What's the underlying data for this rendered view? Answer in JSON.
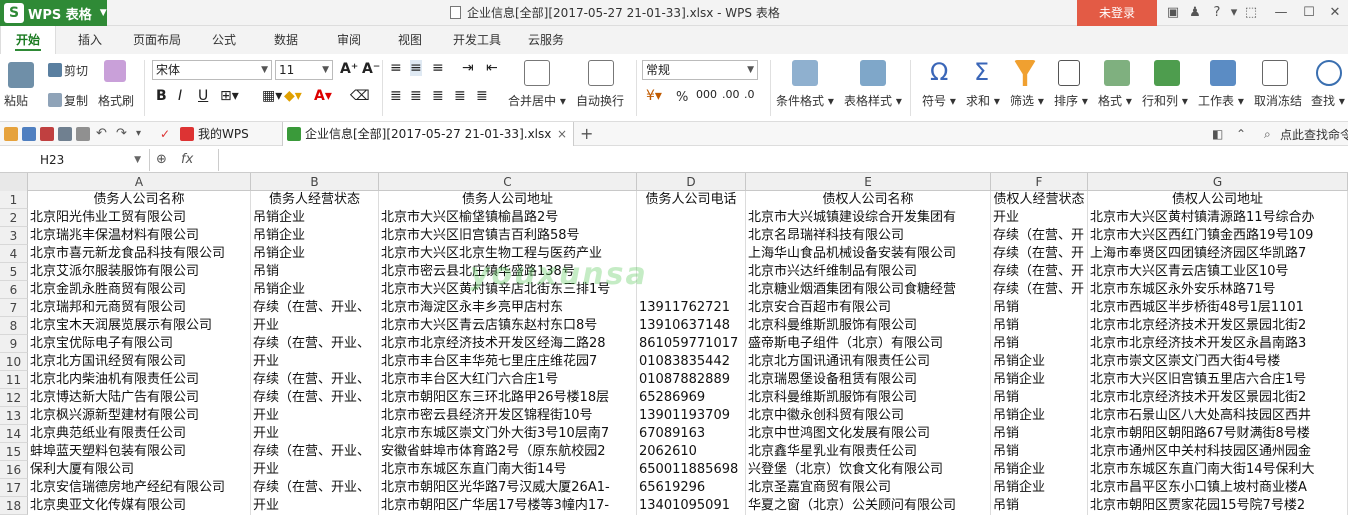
{
  "titlebar": {
    "app_name": "WPS 表格",
    "doc_title": "企业信息[全部][2017-05-27 21-01-33].xlsx - WPS 表格",
    "login": "未登录"
  },
  "tabs": [
    "开始",
    "插入",
    "页面布局",
    "公式",
    "数据",
    "审阅",
    "视图",
    "开发工具",
    "云服务"
  ],
  "ribbon": {
    "paste": "粘贴",
    "cut": "剪切",
    "copy": "复制",
    "format_painter": "格式刷",
    "font_name": "宋体",
    "font_size": "11",
    "merge_center": "合并居中",
    "wrap_text": "自动换行",
    "number_format": "常规",
    "percent": "%",
    "conditional_format": "条件格式",
    "table_style": "表格样式",
    "symbol": "符号",
    "sum": "求和",
    "filter": "筛选",
    "sort": "排序",
    "format": "格式",
    "rows_cols": "行和列",
    "worksheet": "工作表",
    "freeze": "取消冻结",
    "find": "查找"
  },
  "quickbar": {
    "my_wps": "我的WPS",
    "doc_tab": "企业信息[全部][2017-05-27 21-01-33].xlsx",
    "search": "点此查找命令"
  },
  "formula": {
    "cell_ref": "H23",
    "fx": "fx",
    "value": ""
  },
  "columns": [
    "A",
    "B",
    "C",
    "D",
    "E",
    "F",
    "G"
  ],
  "rows": [
    [
      "债务人公司名称",
      "债务人经营状态",
      "债务人公司地址",
      "债务人公司电话",
      "债权人公司名称",
      "债权人经营状态",
      "债权人公司地址"
    ],
    [
      "北京阳光伟业工贸有限公司",
      "吊销企业",
      "北京市大兴区榆垡镇榆昌路2号",
      "",
      "北京市大兴城镇建设综合开发集团有",
      "开业",
      "北京市大兴区黄村镇清源路11号综合办"
    ],
    [
      "北京瑞兆丰保温材料有限公司",
      "吊销企业",
      "北京市大兴区旧宫镇吉百利路58号",
      "",
      "北京名昂瑞祥科技有限公司",
      "存续（在营、开",
      "北京市大兴区西红门镇金西路19号109"
    ],
    [
      "北京市喜元新龙食品科技有限公司",
      "吊销企业",
      "北京市大兴区北京生物工程与医药产业",
      "",
      "上海华山食品机械设备安装有限公司",
      "存续（在营、开",
      "上海市奉贤区四团镇经济园区华凯路7"
    ],
    [
      "北京艾派尔服装服饰有限公司",
      "吊销",
      "北京市密云县北庄镇华盛路138号",
      "",
      "北京市兴达纤维制品有限公司",
      "存续（在营、开",
      "北京市大兴区青云店镇工业区10号"
    ],
    [
      "北京金凯永胜商贸有限公司",
      "吊销企业",
      "北京市大兴区黄村镇辛店北街东三排1号",
      "",
      "北京糖业烟酒集团有限公司食糖经营",
      "存续（在营、开",
      "北京市东城区永外安乐林路71号"
    ],
    [
      "北京瑞邦和元商贸有限公司",
      "存续（在营、开业、",
      "北京市海淀区永丰乡亮甲店村东",
      "13911762721",
      "北京安合百超市有限公司",
      "吊销",
      "北京市西城区半步桥街48号1层1101"
    ],
    [
      "北京宝木天润展览展示有限公司",
      "开业",
      "北京市大兴区青云店镇东赵村东口8号",
      "13910637148",
      "北京科曼维斯凯服饰有限公司",
      "吊销",
      "北京市北京经济技术开发区景园北街2"
    ],
    [
      "北京宝优际电子有限公司",
      "存续（在营、开业、",
      "北京市北京经济技术开发区经海二路28",
      "861059771017",
      "盛帝斯电子组件（北京）有限公司",
      "吊销",
      "北京市北京经济技术开发区永昌南路3"
    ],
    [
      "北京北方国讯经贸有限公司",
      "开业",
      "北京市丰台区丰华苑七里庄庄维花园7",
      "01083835442",
      "北京北方国讯通讯有限责任公司",
      "吊销企业",
      "北京市崇文区崇文门西大街4号楼"
    ],
    [
      "北京北内柴油机有限责任公司",
      "存续（在营、开业、",
      "北京市丰台区大红门六合庄1号",
      "01087882889",
      "北京瑞恩堡设备租赁有限公司",
      "吊销企业",
      "北京市大兴区旧宫镇五里店六合庄1号"
    ],
    [
      "北京博达新大陆广告有限公司",
      "存续（在营、开业、",
      "北京市朝阳区东三环北路甲26号楼18层",
      "65286969",
      "北京科曼维斯凯服饰有限公司",
      "吊销",
      "北京市北京经济技术开发区景园北街2"
    ],
    [
      "北京枫兴源新型建材有限公司",
      "开业",
      "北京市密云县经济开发区锦程街10号",
      "13901193709",
      "北京中徽永创科贸有限公司",
      "吊销企业",
      "北京市石景山区八大处高科技园区西井"
    ],
    [
      "北京典范纸业有限责任公司",
      "开业",
      "北京市东城区崇文门外大街3号10层南7",
      "67089163",
      "北京中世鸿图文化发展有限公司",
      "吊销",
      "北京市朝阳区朝阳路67号财满街8号楼"
    ],
    [
      "蚌埠蓝天塑料包装有限公司",
      "存续（在营、开业、",
      "安徽省蚌埠市体育路2号（原东航校园2",
      "2062610",
      "北京鑫华星乳业有限责任公司",
      "吊销",
      "北京市通州区中关村科技园区通州园金"
    ],
    [
      "保利大厦有限公司",
      "开业",
      "北京市东城区东直门南大街14号",
      "650011885698",
      "兴登堡（北京）饮食文化有限公司",
      "吊销企业",
      "北京市东城区东直门南大街14号保利大"
    ],
    [
      "北京安信瑞德房地产经纪有限公司",
      "存续（在营、开业、",
      "北京市朝阳区光华路7号汉威大厦26A1-",
      "65619296",
      "北京圣嘉宜商贸有限公司",
      "吊销企业",
      "北京市昌平区东小口镇上坡村商业楼A"
    ],
    [
      "北京奥亚文化传媒有限公司",
      "开业",
      "北京市朝阳区广华居17号楼等3幢内17-",
      "13401095091",
      "华夏之窗（北京）公关顾问有限公司",
      "吊销",
      "北京市朝阳区贾家花园15号院7号楼2"
    ]
  ],
  "watermark": "youxunsa"
}
